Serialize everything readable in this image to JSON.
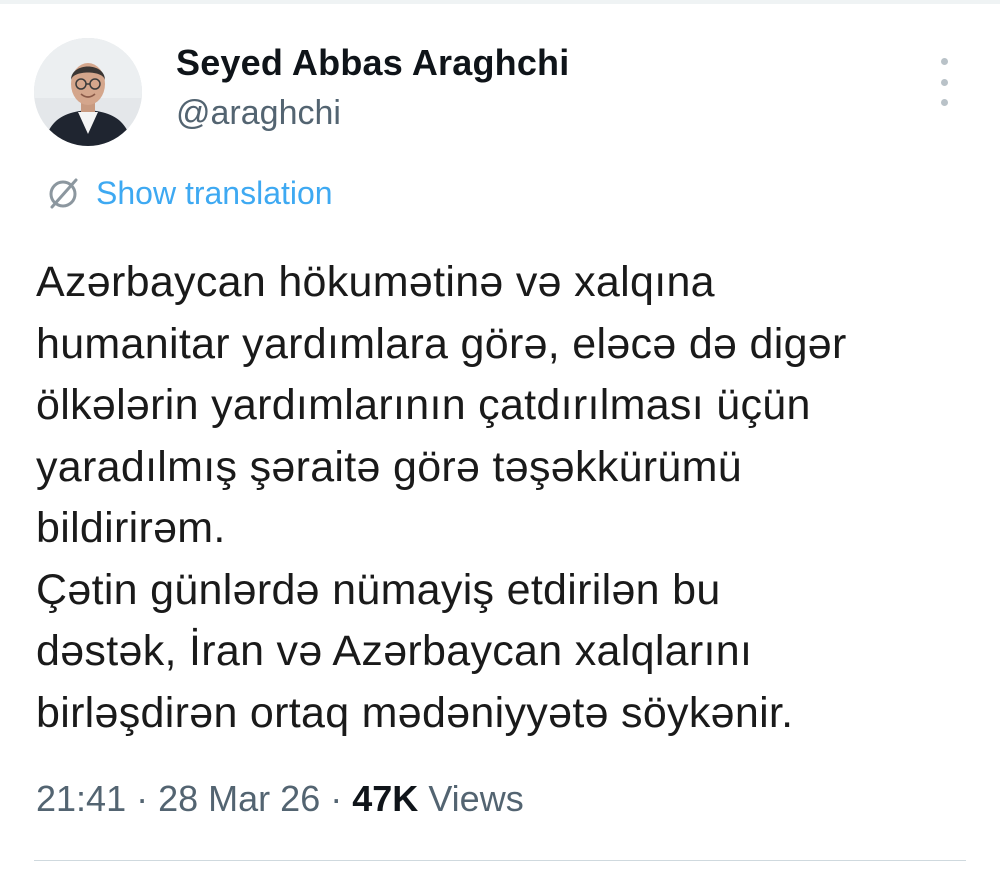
{
  "tweet": {
    "author": {
      "display_name": "Seyed Abbas Araghchi",
      "handle": "@araghchi",
      "avatar_icon": "profile-photo"
    },
    "more_icon": "more-vertical-icon",
    "translation": {
      "label": "Show translation",
      "icon": "translate-icon",
      "color": "#1d9bf0"
    },
    "text_lines": [
      "Azərbaycan hökumətinə və xalqına",
      "humanitar yardımlara görə, eləcə də digər",
      "ölkələrin yardımlarının çatdırılması üçün",
      "yaradılmış şəraitə görə təşəkkürümü",
      "bildirirəm.",
      "Çətin günlərdə nümayiş etdirilən bu",
      "dəstək, İran və Azərbaycan xalqlarını",
      "birləşdirən ortaq mədəniyyətə söykənir."
    ],
    "time": "21:41",
    "date": "28 Mar 26",
    "separator": "·",
    "views_count": "47K",
    "views_label": "Views"
  }
}
